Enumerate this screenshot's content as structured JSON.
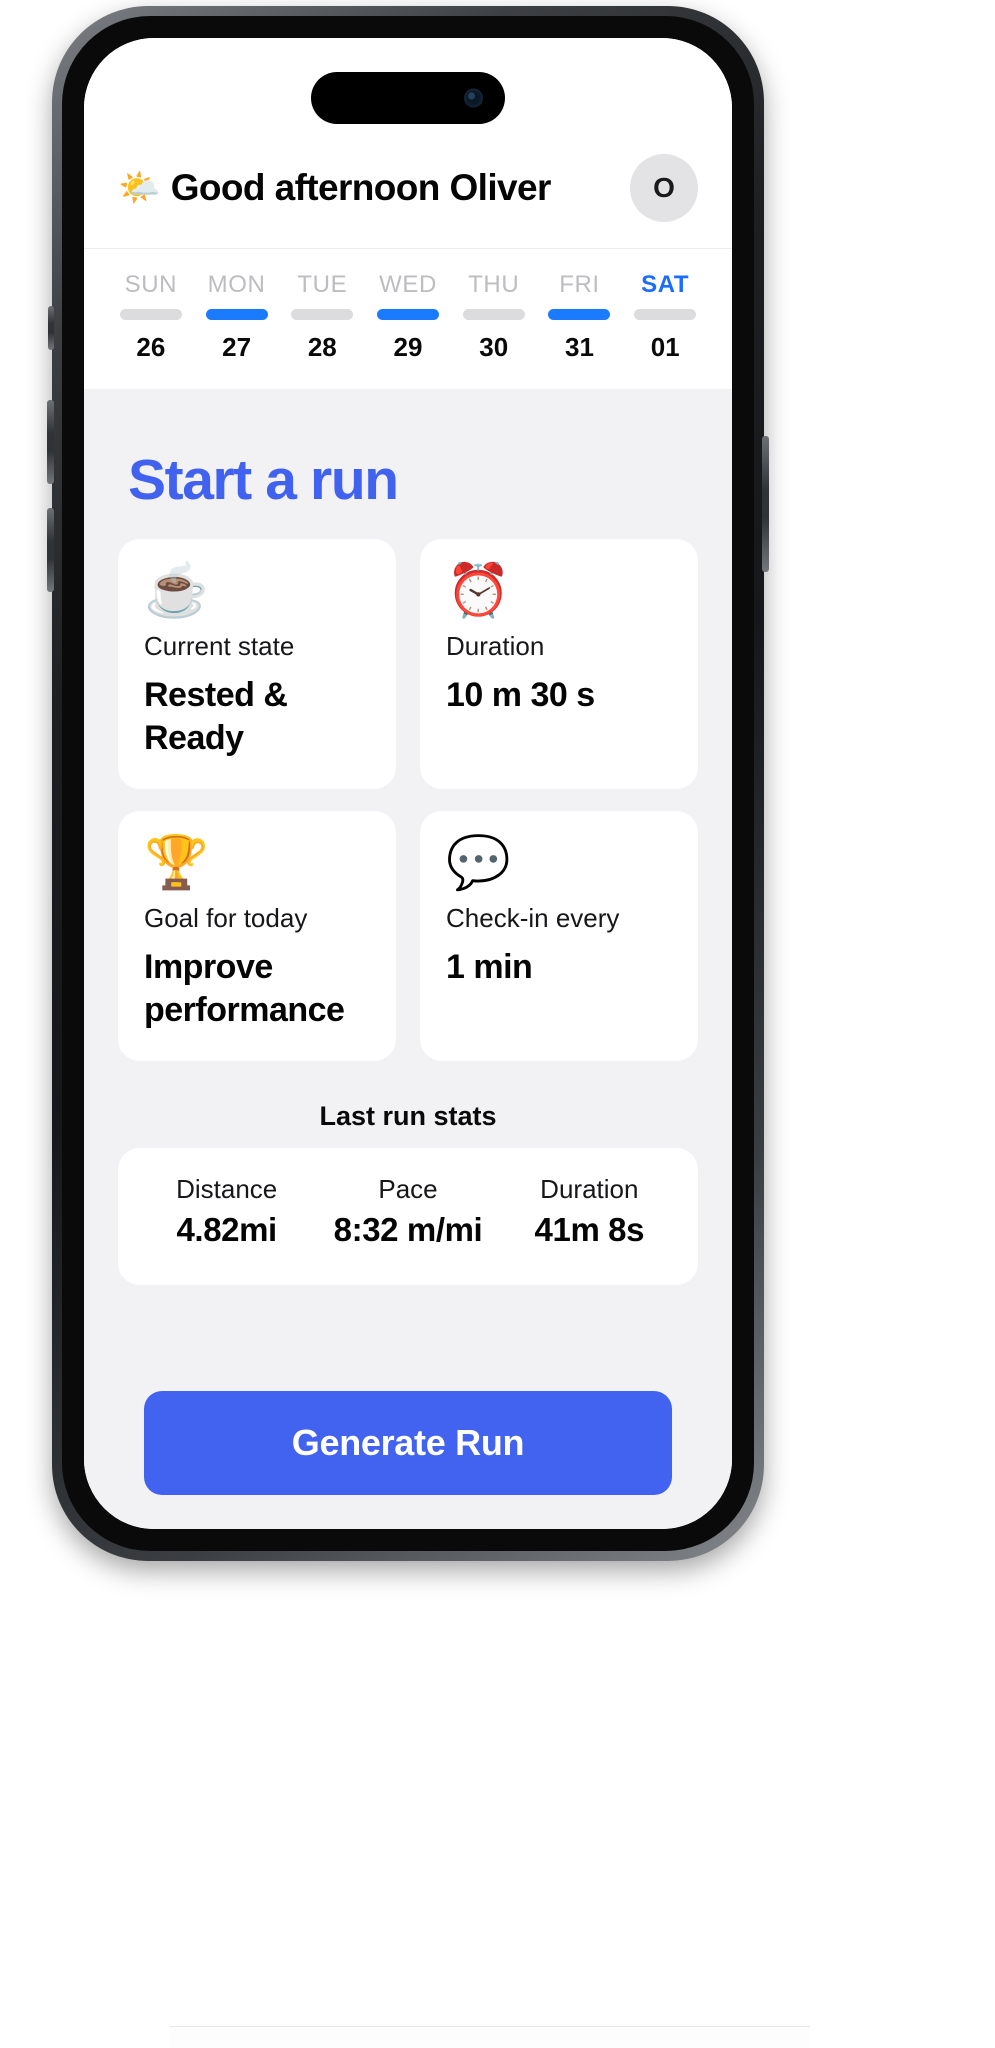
{
  "header": {
    "weather_icon": "sun-behind-cloud-emoji",
    "weather_emoji": "🌤️",
    "greeting": "Good afternoon Oliver",
    "avatar_initial": "O"
  },
  "week": {
    "days": [
      {
        "label": "SUN",
        "date": "26",
        "active": false,
        "bar": "inactive"
      },
      {
        "label": "MON",
        "date": "27",
        "active": false,
        "bar": "active"
      },
      {
        "label": "TUE",
        "date": "28",
        "active": false,
        "bar": "inactive"
      },
      {
        "label": "WED",
        "date": "29",
        "active": false,
        "bar": "active"
      },
      {
        "label": "THU",
        "date": "30",
        "active": false,
        "bar": "inactive"
      },
      {
        "label": "FRI",
        "date": "31",
        "active": false,
        "bar": "active"
      },
      {
        "label": "SAT",
        "date": "01",
        "active": true,
        "bar": "inactive"
      }
    ]
  },
  "main": {
    "title": "Start a run",
    "cards": [
      {
        "icon": "coffee-mug-emoji",
        "emoji": "☕",
        "label": "Current state",
        "value": "Rested & Ready"
      },
      {
        "icon": "alarm-clock-emoji",
        "emoji": "⏰",
        "label": "Duration",
        "value": "10 m 30 s"
      },
      {
        "icon": "trophy-emoji",
        "emoji": "🏆",
        "label": "Goal for today",
        "value": "Improve performance"
      },
      {
        "icon": "speech-balloons-emoji",
        "emoji": "💬",
        "label": "Check-in every",
        "value": "1 min"
      }
    ],
    "last_run": {
      "title": "Last run stats",
      "stats": [
        {
          "label": "Distance",
          "value": "4.82mi"
        },
        {
          "label": "Pace",
          "value": "8:32 m/mi"
        },
        {
          "label": "Duration",
          "value": "41m 8s"
        }
      ]
    },
    "cta_label": "Generate Run"
  },
  "colors": {
    "accent_blue": "#4262f0",
    "day_bar_blue": "#1a7bff",
    "sat_blue": "#1a6dff",
    "screen_bg": "#f2f2f4",
    "card_bg": "#ffffff"
  }
}
